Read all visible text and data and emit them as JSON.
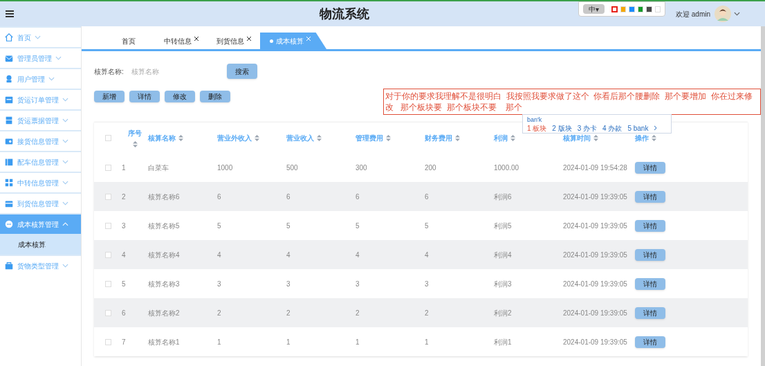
{
  "header": {
    "title": "物流系统",
    "welcome": "欢迎 admin",
    "ime_toolbar": {
      "mode": "中▾",
      "swatches": [
        {
          "color": "#e8231a",
          "selected": true
        },
        {
          "color": "#f5a800",
          "selected": false
        },
        {
          "color": "#1a8cff",
          "selected": false
        },
        {
          "color": "#159a2a",
          "selected": false
        },
        {
          "color": "#4a4a4a",
          "selected": false
        },
        {
          "color": "#ffffff",
          "selected": false
        }
      ]
    }
  },
  "sidebar": {
    "items": [
      {
        "label": "首页",
        "expanded": false,
        "selected": false
      },
      {
        "label": "管理员管理",
        "expanded": false,
        "selected": false
      },
      {
        "label": "用户管理",
        "expanded": false,
        "selected": false
      },
      {
        "label": "货运订单管理",
        "expanded": false,
        "selected": false
      },
      {
        "label": "货运票据管理",
        "expanded": false,
        "selected": false
      },
      {
        "label": "接货信息管理",
        "expanded": false,
        "selected": false
      },
      {
        "label": "配车信息管理",
        "expanded": false,
        "selected": false
      },
      {
        "label": "中转信息管理",
        "expanded": false,
        "selected": false
      },
      {
        "label": "到货信息管理",
        "expanded": false,
        "selected": false
      },
      {
        "label": "成本核算管理",
        "expanded": true,
        "selected": true,
        "children": [
          {
            "label": "成本核算",
            "selected": true
          }
        ]
      },
      {
        "label": "货物类型管理",
        "expanded": false,
        "selected": false
      }
    ]
  },
  "tabs": [
    {
      "label": "首页",
      "closable": false,
      "selected": false
    },
    {
      "label": "中转信息",
      "closable": true,
      "selected": false
    },
    {
      "label": "到货信息",
      "closable": true,
      "selected": false
    },
    {
      "label": "成本核算",
      "closable": true,
      "selected": true
    }
  ],
  "search": {
    "label": "核算名称:",
    "placeholder": "核算名称",
    "button": "搜索"
  },
  "actions": [
    "新增",
    "详情",
    "修改",
    "删除"
  ],
  "annotation": {
    "text": "对于你的要求我理解不是很明白  我按照我要求做了这个  你看后那个腰删除  那个要增加  你在过来修改   那个板块要  那个板块不要    那个"
  },
  "ime_popup": {
    "input": "ban'k",
    "candidates": [
      {
        "index": "1",
        "text": "板块",
        "selected": true
      },
      {
        "index": "2",
        "text": "版块",
        "selected": false
      },
      {
        "index": "3",
        "text": "办卡",
        "selected": false
      },
      {
        "index": "4",
        "text": "办款",
        "selected": false
      },
      {
        "index": "5",
        "text": "bank",
        "selected": false
      }
    ]
  },
  "table": {
    "select_all_checked": false,
    "columns": [
      "序号",
      "核算名称",
      "营业外收入",
      "营业收入",
      "管理费用",
      "财务费用",
      "利润",
      "核算时间",
      "操作"
    ],
    "rows": [
      {
        "checked": false,
        "cells": [
          "1",
          "白菜车",
          "1000",
          "500",
          "300",
          "200",
          "1000.00",
          "2024-01-09 19:54:28"
        ],
        "action": "详情"
      },
      {
        "checked": false,
        "cells": [
          "2",
          "核算名称6",
          "6",
          "6",
          "6",
          "6",
          "利润6",
          "2024-01-09 19:39:05"
        ],
        "action": "详情"
      },
      {
        "checked": false,
        "cells": [
          "3",
          "核算名称5",
          "5",
          "5",
          "5",
          "5",
          "利润5",
          "2024-01-09 19:39:05"
        ],
        "action": "详情"
      },
      {
        "checked": false,
        "cells": [
          "4",
          "核算名称4",
          "4",
          "4",
          "4",
          "4",
          "利润4",
          "2024-01-09 19:39:05"
        ],
        "action": "详情"
      },
      {
        "checked": false,
        "cells": [
          "5",
          "核算名称3",
          "3",
          "3",
          "3",
          "3",
          "利润3",
          "2024-01-09 19:39:05"
        ],
        "action": "详情"
      },
      {
        "checked": false,
        "cells": [
          "6",
          "核算名称2",
          "2",
          "2",
          "2",
          "2",
          "利润2",
          "2024-01-09 19:39:05"
        ],
        "action": "详情"
      },
      {
        "checked": false,
        "cells": [
          "7",
          "核算名称1",
          "1",
          "1",
          "1",
          "1",
          "利润1",
          "2024-01-09 19:39:05"
        ],
        "action": "详情"
      }
    ]
  }
}
